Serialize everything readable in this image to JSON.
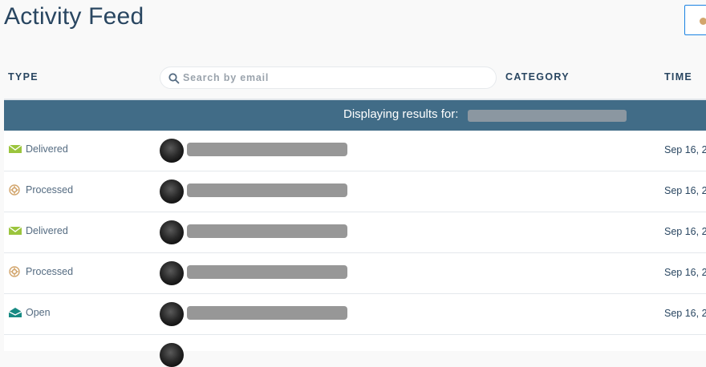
{
  "page": {
    "title": "Activity Feed"
  },
  "columns": {
    "type": "TYPE",
    "category": "CATEGORY",
    "time": "TIME"
  },
  "search": {
    "placeholder": "Search by email",
    "value": ""
  },
  "banner": {
    "label": "Displaying results for:"
  },
  "events": [
    {
      "type": "Delivered",
      "icon": "delivered-envelope-icon",
      "time": "Sep 16, 2"
    },
    {
      "type": "Processed",
      "icon": "processed-gear-icon",
      "time": "Sep 16, 2"
    },
    {
      "type": "Delivered",
      "icon": "delivered-envelope-icon",
      "time": "Sep 16, 2"
    },
    {
      "type": "Processed",
      "icon": "processed-gear-icon",
      "time": "Sep 16, 2"
    },
    {
      "type": "Open",
      "icon": "open-envelope-icon",
      "time": "Sep 16, 2"
    }
  ],
  "colors": {
    "title": "#294661",
    "banner": "#416c87",
    "delivered": "#9bc53d",
    "processed": "#d2a56c",
    "open": "#178a83"
  }
}
